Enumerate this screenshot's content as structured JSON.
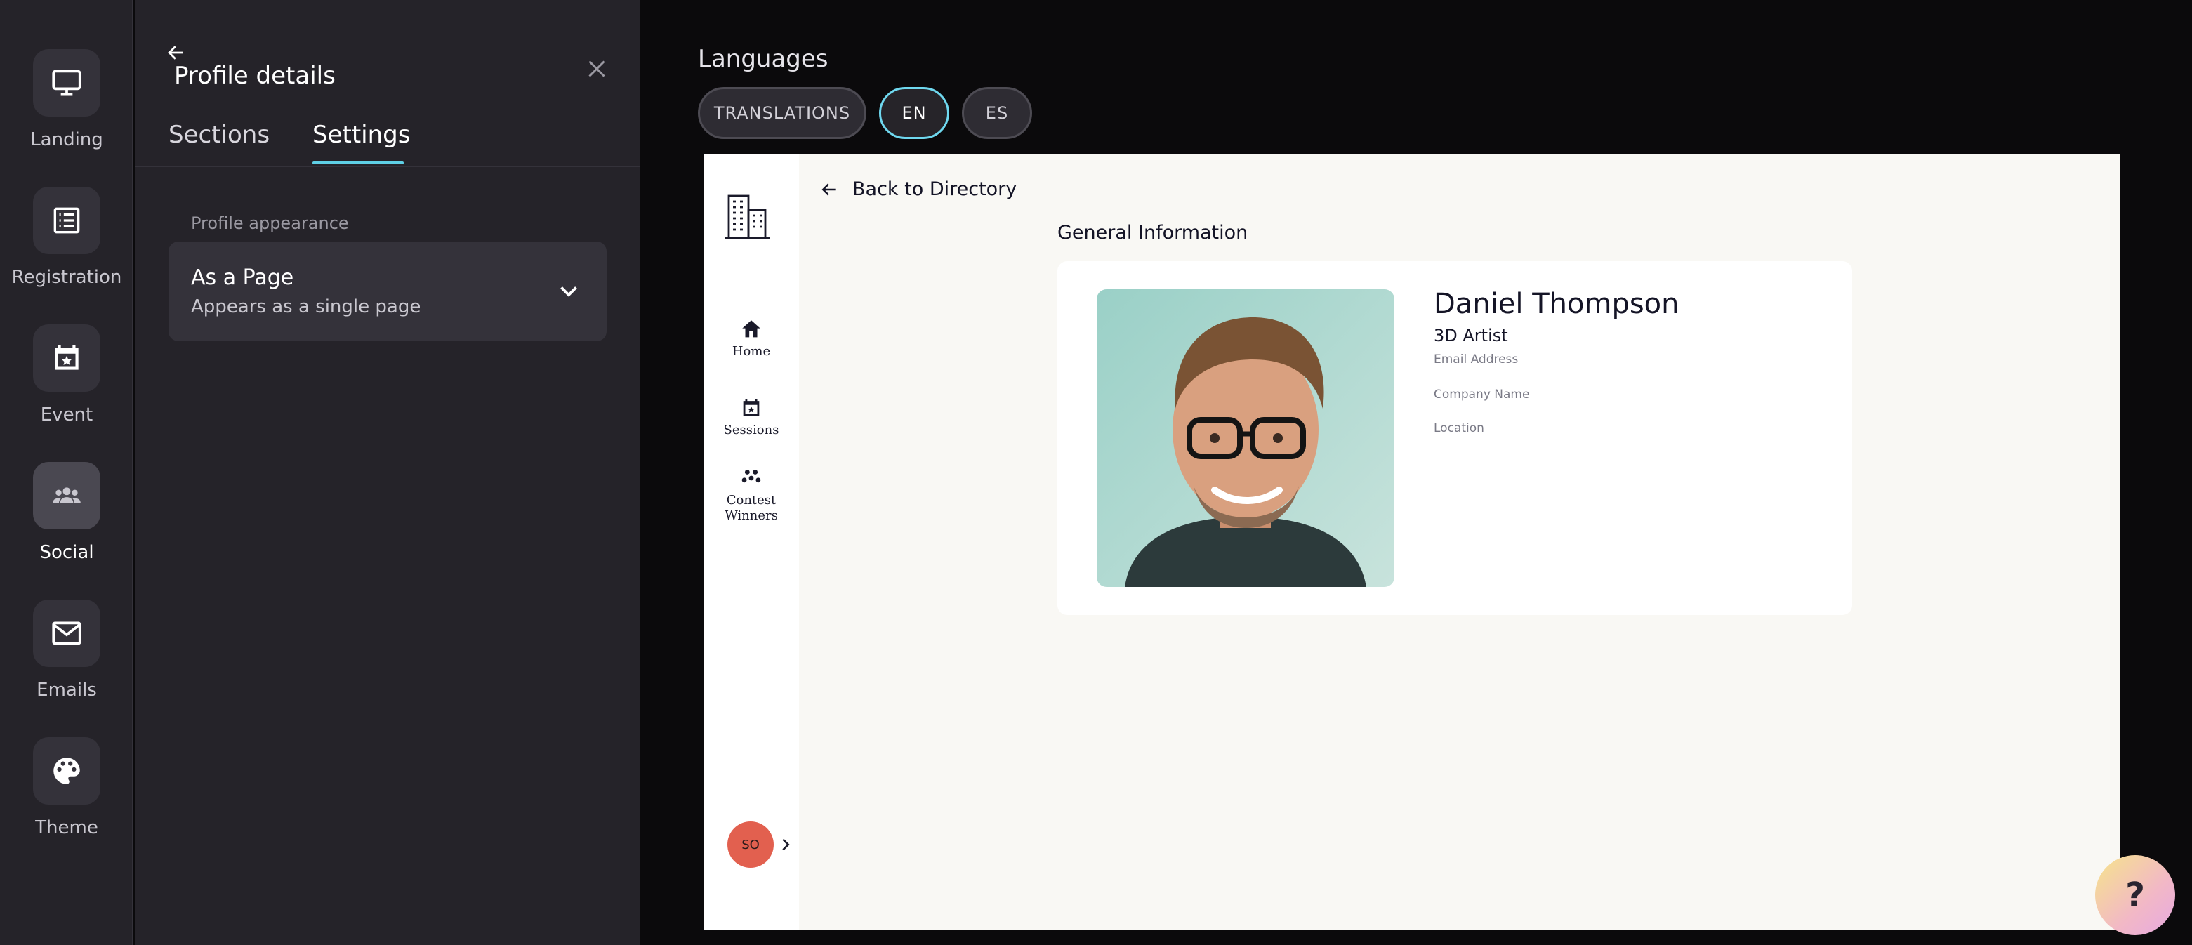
{
  "rail": {
    "items": [
      {
        "label": "Landing",
        "icon": "monitor-icon",
        "active": false
      },
      {
        "label": "Registration",
        "icon": "list-icon",
        "active": false
      },
      {
        "label": "Event",
        "icon": "calendar-star-icon",
        "active": false
      },
      {
        "label": "Social",
        "icon": "people-icon",
        "active": true
      },
      {
        "label": "Emails",
        "icon": "mail-icon",
        "active": false
      },
      {
        "label": "Theme",
        "icon": "palette-icon",
        "active": false
      }
    ]
  },
  "panel": {
    "title": "Profile details",
    "tabs": [
      {
        "label": "Sections",
        "active": false
      },
      {
        "label": "Settings",
        "active": true
      }
    ],
    "section_label": "Profile appearance",
    "select": {
      "value": "As a Page",
      "description": "Appears as a single page"
    }
  },
  "languages": {
    "title": "Languages",
    "chips": [
      {
        "label": "TRANSLATIONS",
        "active": false
      },
      {
        "label": "EN",
        "active": true
      },
      {
        "label": "ES",
        "active": false
      }
    ]
  },
  "preview": {
    "nav": [
      {
        "label": "Home",
        "icon": "home-icon"
      },
      {
        "label": "Sessions",
        "icon": "calendar-icon"
      },
      {
        "label": "Contest Winners",
        "icon": "trophy-dots-icon"
      }
    ],
    "avatar_initials": "SO",
    "back_label": "Back to Directory",
    "section_title": "General Information",
    "profile": {
      "name": "Daniel Thompson",
      "role": "3D Artist",
      "fields": [
        "Email Address",
        "Company Name",
        "Location"
      ]
    }
  },
  "help_label": "?",
  "colors": {
    "accent": "#5fd0e6",
    "avatar": "#e2604f"
  }
}
